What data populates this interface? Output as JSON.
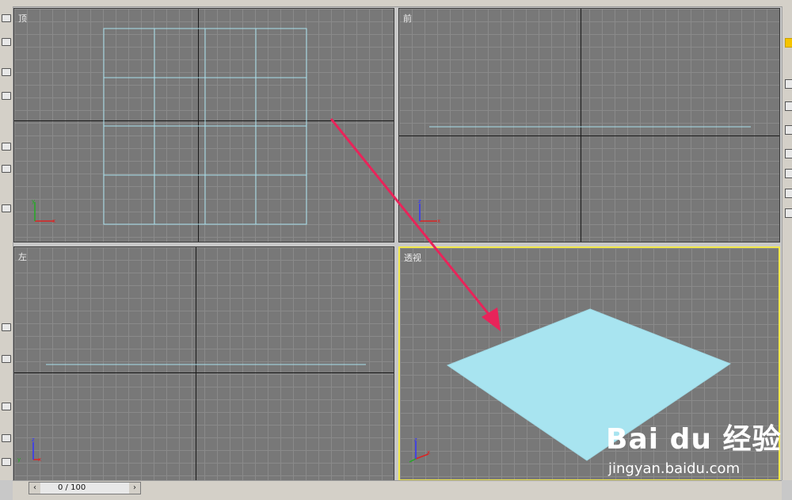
{
  "viewports": {
    "top": {
      "label": "顶"
    },
    "front": {
      "label": "前"
    },
    "left": {
      "label": "左"
    },
    "perspective": {
      "label": "透视"
    }
  },
  "timeline": {
    "counter": "0 / 100",
    "prev_icon": "chevron-left-icon",
    "next_icon": "chevron-right-icon"
  },
  "watermark": {
    "brand": "Bai du 经验",
    "url": "jingyan.baidu.com"
  },
  "colors": {
    "viewport_bg": "#787878",
    "grid_line": "#8a8a8a",
    "object_wire": "#a8e0ec",
    "plane_fill": "#a8e4f0",
    "active_border": "#f2e84a",
    "annotation_arrow": "#e8245a"
  }
}
